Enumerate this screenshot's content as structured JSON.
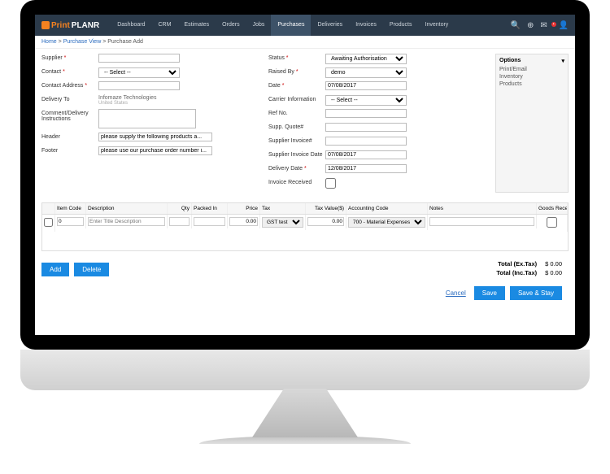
{
  "brand": {
    "left": "Print",
    "right": "PLANR"
  },
  "nav": {
    "items": [
      "Dashboard",
      "CRM",
      "Estimates",
      "Orders",
      "Jobs",
      "Purchases",
      "Deliveries",
      "Invoices",
      "Products",
      "Inventory"
    ],
    "active": "Purchases"
  },
  "crumbs": {
    "home": "Home",
    "view": "Purchase View",
    "current": "Purchase Add"
  },
  "left": {
    "supplier": {
      "label": "Supplier",
      "value": ""
    },
    "contact": {
      "label": "Contact",
      "value": "-- Select --"
    },
    "contact_address": {
      "label": "Contact Address",
      "value": ""
    },
    "delivery_to": {
      "label": "Delivery To",
      "value": "Infomaze Technologies",
      "sub": "United States"
    },
    "comment": {
      "label": "Comment/Delivery Instructions",
      "value": ""
    },
    "header": {
      "label": "Header",
      "value": "please supply the following products a..."
    },
    "footer": {
      "label": "Footer",
      "value": "please use our purchase order number i..."
    }
  },
  "right": {
    "status": {
      "label": "Status",
      "value": "Awaiting Authorisation"
    },
    "raised_by": {
      "label": "Raised By",
      "value": "demo"
    },
    "date": {
      "label": "Date",
      "value": "07/08/2017"
    },
    "carrier": {
      "label": "Carrier Information",
      "value": "-- Select --"
    },
    "refno": {
      "label": "Ref No.",
      "value": ""
    },
    "supp_quote": {
      "label": "Supp. Quote#",
      "value": ""
    },
    "supp_invoice": {
      "label": "Supplier Invoice#",
      "value": ""
    },
    "supp_inv_date": {
      "label": "Supplier Invoice Date",
      "value": "07/08/2017"
    },
    "delivery_date": {
      "label": "Delivery Date",
      "value": "12/08/2017"
    },
    "invoice_received": {
      "label": "Invoice Received"
    }
  },
  "options": {
    "header": "Options",
    "items": [
      "Print/Email",
      "Inventory",
      "Products"
    ]
  },
  "grid": {
    "headers": {
      "code": "Item Code",
      "desc": "Description",
      "qty": "Qty",
      "pack": "Packed In",
      "price": "Price",
      "tax": "Tax",
      "taxv": "Tax Value($)",
      "acct": "Accounting Code",
      "notes": "Notes",
      "recv": "Goods Received"
    },
    "row": {
      "code": "0",
      "desc": "Enter Title Description",
      "qty": "",
      "pack": "",
      "price": "0.00",
      "tax": "GST test",
      "taxv": "0.00",
      "acct": "700 - Material Expenses",
      "notes": ""
    }
  },
  "buttons": {
    "add": "Add",
    "delete": "Delete",
    "cancel": "Cancel",
    "save": "Save",
    "savestay": "Save & Stay"
  },
  "totals": {
    "ex_label": "Total (Ex.Tax)",
    "ex_val": "$ 0.00",
    "inc_label": "Total (Inc.Tax)",
    "inc_val": "$ 0.00"
  }
}
